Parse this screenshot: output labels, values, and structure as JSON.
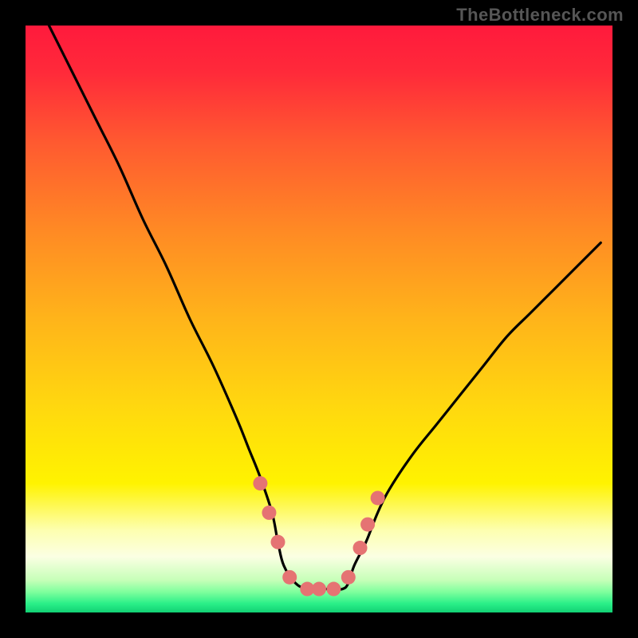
{
  "watermark": "TheBottleneck.com",
  "chart_data": {
    "type": "line",
    "title": "",
    "xlabel": "",
    "ylabel": "",
    "xlim": [
      0,
      100
    ],
    "ylim": [
      0,
      100
    ],
    "series": [
      {
        "name": "bottleneck-curve",
        "x": [
          4,
          8,
          12,
          16,
          20,
          24,
          28,
          32,
          36,
          38,
          40,
          42,
          43,
          44,
          46,
          48,
          50,
          52,
          54,
          55,
          56,
          58,
          60,
          62,
          66,
          70,
          74,
          78,
          82,
          86,
          90,
          94,
          98
        ],
        "values": [
          100,
          92,
          84,
          76,
          67,
          59,
          50,
          42,
          33,
          28,
          23,
          17,
          12,
          8,
          5,
          4,
          4,
          4,
          4,
          5,
          8,
          12,
          17,
          21,
          27,
          32,
          37,
          42,
          47,
          51,
          55,
          59,
          63
        ]
      }
    ],
    "markers": {
      "name": "highlight-points",
      "x": [
        40.0,
        41.5,
        43.0,
        45.0,
        48.0,
        50.0,
        52.5,
        55.0,
        57.0,
        58.3,
        60.0
      ],
      "values": [
        22.0,
        17.0,
        12.0,
        6.0,
        4.0,
        4.0,
        4.0,
        6.0,
        11.0,
        15.0,
        19.5
      ]
    },
    "gradient_bands": [
      {
        "stop": 0.0,
        "color": "#ff1a3c"
      },
      {
        "stop": 0.08,
        "color": "#ff2a3a"
      },
      {
        "stop": 0.2,
        "color": "#ff5a30"
      },
      {
        "stop": 0.35,
        "color": "#ff8a24"
      },
      {
        "stop": 0.5,
        "color": "#ffb41a"
      },
      {
        "stop": 0.65,
        "color": "#ffd80f"
      },
      {
        "stop": 0.78,
        "color": "#fff300"
      },
      {
        "stop": 0.86,
        "color": "#fdffb0"
      },
      {
        "stop": 0.905,
        "color": "#fbffe3"
      },
      {
        "stop": 0.945,
        "color": "#c6ffb8"
      },
      {
        "stop": 0.965,
        "color": "#7fff9d"
      },
      {
        "stop": 0.985,
        "color": "#2aef88"
      },
      {
        "stop": 1.0,
        "color": "#12d074"
      }
    ],
    "marker_color": "#e57373",
    "curve_color": "#000000"
  }
}
